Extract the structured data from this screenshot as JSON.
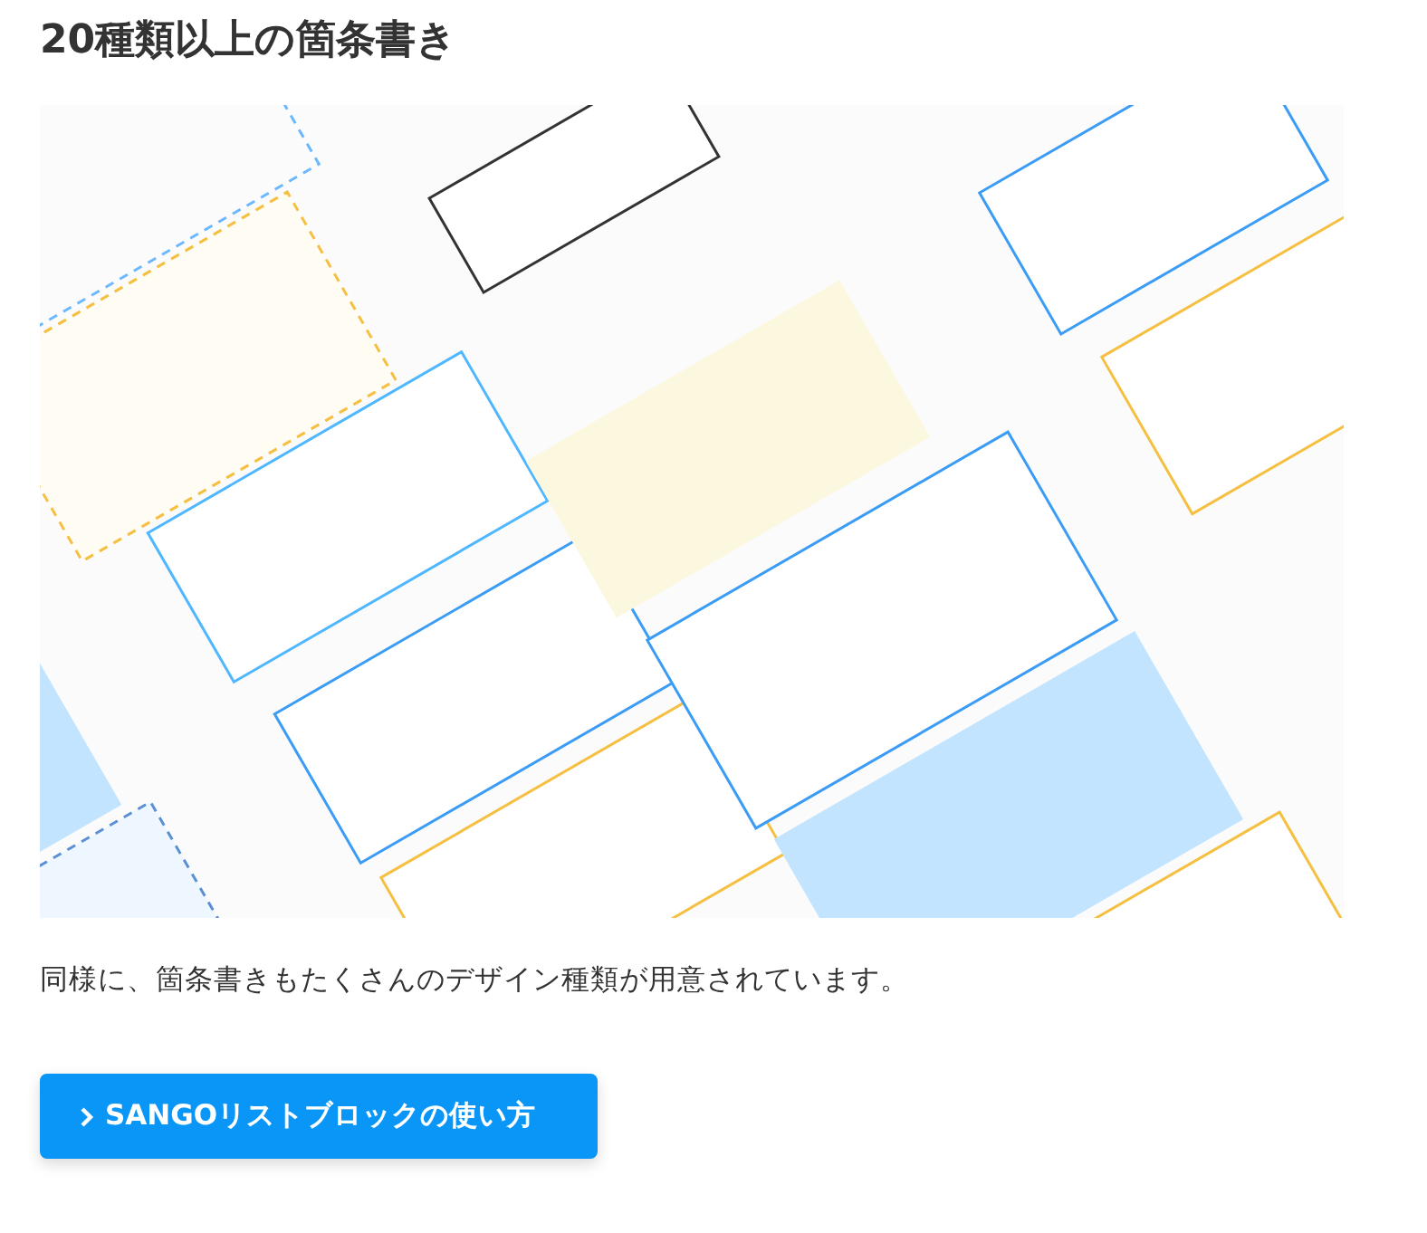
{
  "heading": "20種類以上の箇条書き",
  "paragraph": "同様に、箇条書きもたくさんのデザイン種類が用意されています。",
  "button": {
    "label": "SANGOリストブロックの使い方"
  }
}
